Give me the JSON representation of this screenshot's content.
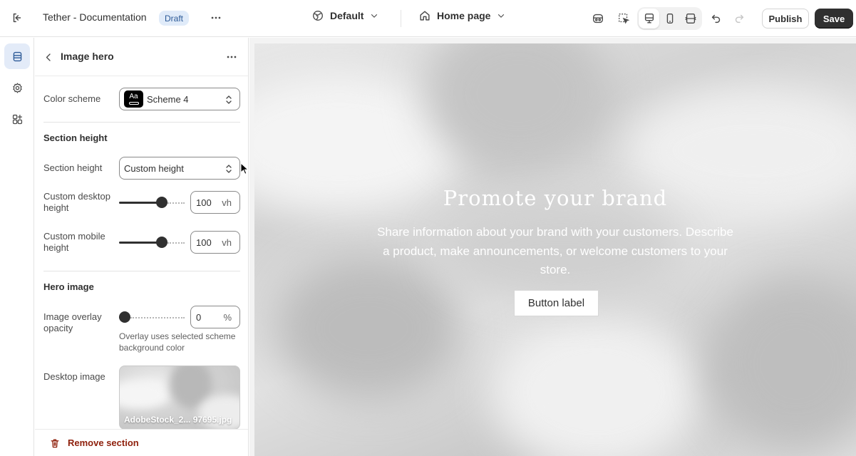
{
  "topbar": {
    "store_title": "Tether - Documentation",
    "status_badge": "Draft",
    "theme_selector": "Default",
    "page_selector": "Home page",
    "publish_label": "Publish",
    "save_label": "Save",
    "icons": [
      "exit-icon",
      "more-horizontal-icon",
      "theme-globe-icon",
      "chevron-down-icon",
      "home-icon",
      "inspector-icon",
      "select-element-icon",
      "desktop-icon",
      "mobile-icon",
      "full-width-icon",
      "undo-icon",
      "redo-icon"
    ]
  },
  "rail": {
    "icons": [
      "sections-icon",
      "settings-gear-icon",
      "apps-icon"
    ]
  },
  "panel": {
    "title": "Image hero",
    "color_scheme": {
      "label": "Color scheme",
      "value": "Scheme 4",
      "swatch_text": "Aa"
    },
    "section_height_heading": "Section height",
    "section_height": {
      "label": "Section height",
      "value": "Custom height"
    },
    "custom_desktop_height": {
      "label": "Custom desktop height",
      "value": "100",
      "unit": "vh",
      "slider_fraction": 0.68
    },
    "custom_mobile_height": {
      "label": "Custom mobile height",
      "value": "100",
      "unit": "vh",
      "slider_fraction": 0.68
    },
    "hero_image_heading": "Hero image",
    "image_overlay_opacity": {
      "label": "Image overlay opacity",
      "value": "0",
      "unit": "%",
      "slider_fraction": 0.0
    },
    "overlay_help": "Overlay uses selected scheme background color",
    "desktop_image": {
      "label": "Desktop image",
      "filename": "AdobeStock_2... 97695.jpg"
    },
    "remove_section": "Remove section"
  },
  "preview": {
    "hero_title": "Promote your brand",
    "hero_text": "Share information about your brand with your customers. Describe a product, make announcements, or welcome customers to your store.",
    "hero_button": "Button label"
  },
  "colors": {
    "accent_blue_bg": "#e3ebf8",
    "accent_blue": "#2c5a97",
    "draft_badge_bg": "#e0ebf9",
    "save_button_bg": "#303030",
    "critical_red": "#8e1f0b"
  }
}
